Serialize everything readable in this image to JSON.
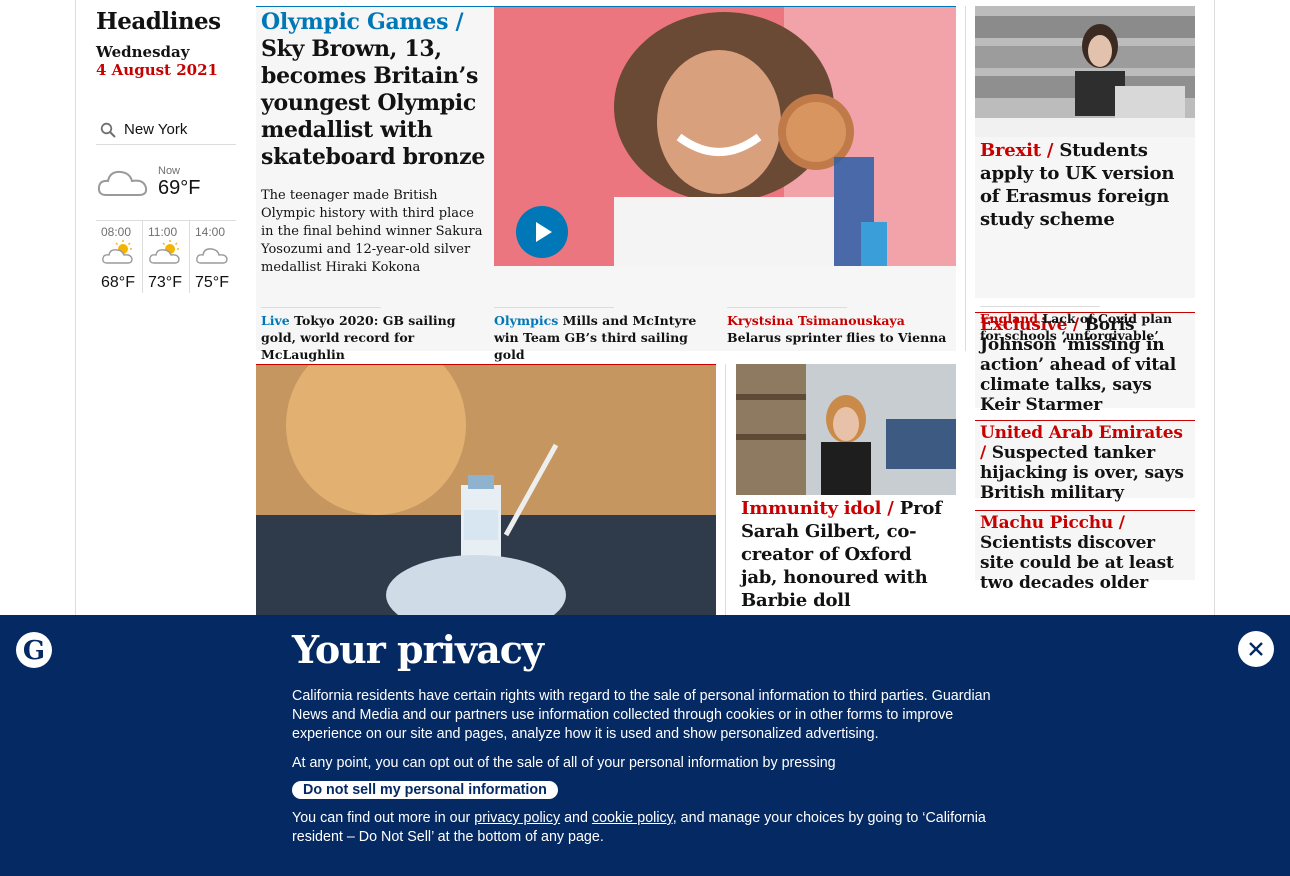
{
  "sidebar": {
    "title": "Headlines",
    "weekday": "Wednesday",
    "date": "4 August 2021",
    "location": "New York",
    "now_label": "Now",
    "now_temp": "69°F",
    "forecast": [
      {
        "time": "08:00",
        "temp": "68°F",
        "icon": "partly-cloudy-icon"
      },
      {
        "time": "11:00",
        "temp": "73°F",
        "icon": "partly-cloudy-icon"
      },
      {
        "time": "14:00",
        "temp": "75°F",
        "icon": "cloud-icon"
      }
    ]
  },
  "top_story": {
    "kicker": "Olympic Games /",
    "headline": "Sky Brown, 13, becomes Britain’s youngest Olympic medallist with skateboard bronze",
    "standfirst": "The teenager made British Olympic history with third place in the final behind winner Sakura Yosozumi and 12-year-old silver medallist Hiraki Kokona",
    "sublinks": [
      {
        "kicker": "Live",
        "text": "Tokyo 2020: GB sailing gold, world record for McLaughlin"
      },
      {
        "kicker": "Olympics",
        "text": "Mills and McIntyre win Team GB’s third sailing gold"
      },
      {
        "kicker": "Krystsina Tsimanouskaya",
        "text": "Belarus sprinter flies to Vienna"
      }
    ]
  },
  "right_col": {
    "brexit": {
      "kicker": "Brexit /",
      "headline": "Students apply to UK version of Erasmus foreign study scheme"
    },
    "england": {
      "kicker": "England",
      "text": "Lack of Covid plan for schools ‘unforgivable’"
    },
    "exclusive": {
      "kicker": "Exclusive /",
      "headline": "Boris Johnson ‘missing in action’ ahead of vital climate talks, says Keir Starmer"
    },
    "uae": {
      "kicker": "United Arab Emirates /",
      "headline": "Suspected tanker hijacking is over, says British military"
    },
    "machu": {
      "kicker": "Machu Picchu /",
      "headline": "Scientists discover site could be at least two decades older"
    }
  },
  "gilbert": {
    "kicker": "Immunity idol /",
    "headline": "Prof Sarah Gilbert, co-creator of Oxford jab, honoured with Barbie doll"
  },
  "privacy": {
    "title": "Your privacy",
    "para1": "California residents have certain rights with regard to the sale of personal information to third parties. Guardian News and Media and our partners use information collected through cookies or in other forms to improve experience on our site and pages, analyze how it is used and show personalized advertising.",
    "para2": "At any point, you can opt out of the sale of all of your personal information by pressing",
    "button": "Do not sell my personal information",
    "para3_a": "You can find out more in our",
    "privacy_link": "privacy policy",
    "para3_and": "and",
    "cookie_link": "cookie policy",
    "para3_b": ", and manage your choices by going to ‘California resident – Do Not Sell’ at the bottom of any page."
  },
  "colors": {
    "red": "#c70000",
    "blue": "#0077b6",
    "banner": "#052962"
  }
}
